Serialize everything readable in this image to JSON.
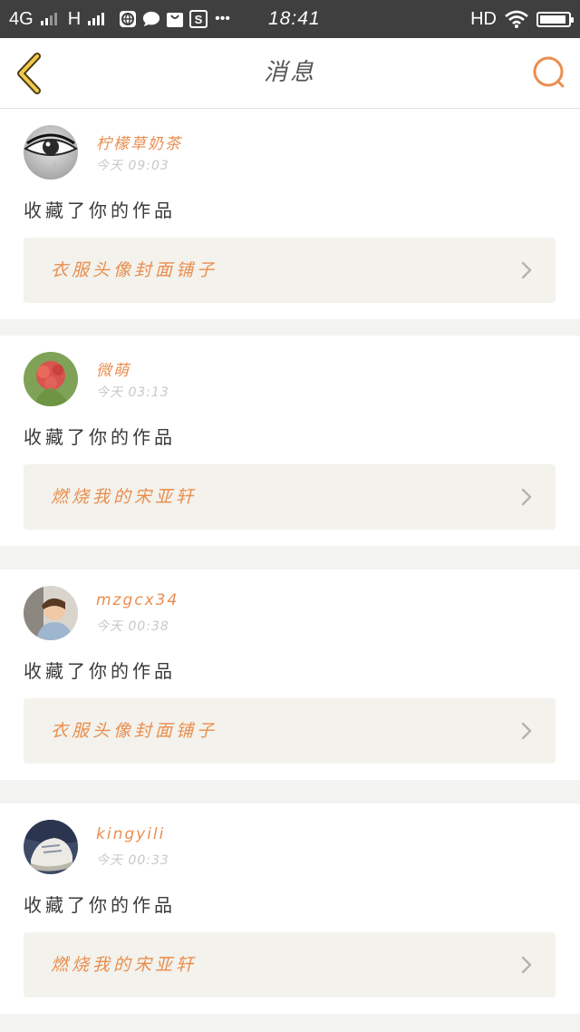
{
  "status_bar": {
    "network_1": "4G",
    "network_2": "H",
    "time": "18:41",
    "hd": "HD",
    "more": "•••",
    "icons": [
      "browser-icon",
      "chat-bubble-icon",
      "shopping-bag-icon",
      "s-app-icon",
      "wifi-icon",
      "battery-icon"
    ]
  },
  "header": {
    "title": "消息",
    "back_icon": "chevron-left-icon",
    "search_icon": "search-icon",
    "accent_color": "#e98e4f"
  },
  "messages": [
    {
      "username": "柠檬草奶茶",
      "time": "今天  09:03",
      "action": "收藏了你的作品",
      "work_title": "衣服头像封面铺子",
      "avatar": "eye-avatar"
    },
    {
      "username": "微萌",
      "time": "今天  03:13",
      "action": "收藏了你的作品",
      "work_title": "燃烧我的宋亚轩",
      "avatar": "flower-avatar"
    },
    {
      "username": "mzgcx34",
      "time": "今天  00:38",
      "action": "收藏了你的作品",
      "work_title": "衣服头像封面铺子",
      "avatar": "boy-avatar"
    },
    {
      "username": "kingyili",
      "time": "今天  00:33",
      "action": "收藏了你的作品",
      "work_title": "燃烧我的宋亚轩",
      "avatar": "shoe-avatar"
    }
  ]
}
